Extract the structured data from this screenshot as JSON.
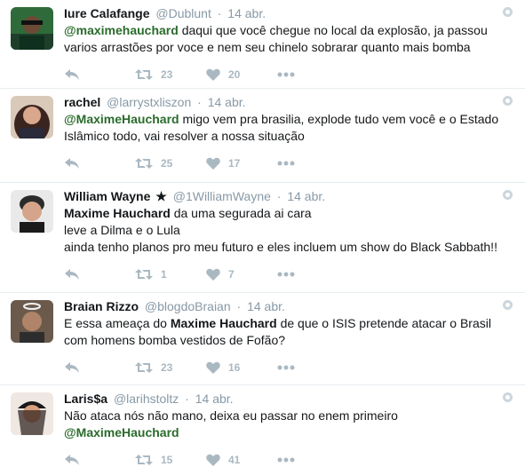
{
  "tweets": [
    {
      "fullname": "Iure Calafange",
      "handle": "@Dublunt",
      "time": "14 abr.",
      "line1": "@maximehauchard",
      "line1_rest": " daqui que você chegue no local da explosão, ja passou",
      "line2": "varios arrastões por voce e nem seu chinelo sobrarar quanto mais bomba",
      "retweets": "23",
      "likes": "20"
    },
    {
      "fullname": "rachel",
      "handle": "@larrystxliszon",
      "time": "14 abr.",
      "line1": "@MaximeHauchard",
      "line1_rest": " migo vem pra brasilia, explode tudo vem você e o Estado",
      "line2": "Islâmico todo, vai resolver a nossa situação",
      "retweets": "25",
      "likes": "17"
    },
    {
      "fullname": "William Wayne",
      "star": "★",
      "handle": "@1WilliamWayne",
      "time": "14 abr.",
      "line1": "Maxime Hauchard",
      "line1_rest": " da uma segurada ai cara",
      "line2": "leve a Dilma e o Lula",
      "line3": "ainda tenho planos pro meu futuro e eles incluem um show do Black Sabbath!!",
      "retweets": "1",
      "likes": "7"
    },
    {
      "fullname": "Braian Rizzo",
      "handle": "@blogdoBraian",
      "time": "14 abr.",
      "line1_pre": "E essa ameaça do ",
      "line1": "Maxime Hauchard",
      "line1_rest": " de que o ISIS pretende atacar o Brasil",
      "line2": "com homens bomba vestidos de Fofão?",
      "retweets": "23",
      "likes": "16"
    },
    {
      "fullname": "Laris$a",
      "handle": "@larihstoltz",
      "time": "14 abr.",
      "line1": "Não ataca nós não mano, deixa eu passar no enem primeiro",
      "line2": "@MaximeHauchard",
      "retweets": "15",
      "likes": "41"
    }
  ],
  "separator": "·",
  "icons": {
    "reply": "reply-icon",
    "retweet": "retweet-icon",
    "like": "heart-icon",
    "more": "more-icon",
    "settings": "gear-icon"
  },
  "colors": {
    "mention": "#2a6b2b",
    "muted": "#8899a6",
    "action": "#aab8c2",
    "border": "#e6ecf0"
  }
}
